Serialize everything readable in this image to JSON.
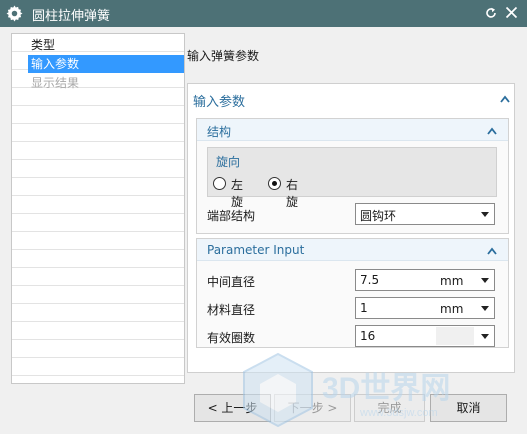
{
  "window": {
    "title": "圆柱拉伸弹簧"
  },
  "nav": {
    "items": [
      {
        "label": "类型",
        "state": "normal"
      },
      {
        "label": "输入参数",
        "state": "selected"
      },
      {
        "label": "显示结果",
        "state": "disabled"
      }
    ]
  },
  "page": {
    "heading": "输入弹簧参数"
  },
  "panel": {
    "title": "输入参数",
    "structure": {
      "title": "结构",
      "direction": {
        "label": "旋向",
        "options": [
          "左旋",
          "右旋"
        ],
        "selected": "右旋"
      },
      "end_structure": {
        "label": "端部结构",
        "value": "圆钩环"
      }
    },
    "parameter_input": {
      "title": "Parameter Input",
      "rows": [
        {
          "label": "中间直径",
          "value": "7.5",
          "unit": "mm"
        },
        {
          "label": "材料直径",
          "value": "1",
          "unit": "mm"
        },
        {
          "label": "有效圈数",
          "value": "16",
          "unit": ""
        }
      ]
    }
  },
  "buttons": {
    "back": "< 上一步",
    "next": "下一步 >",
    "finish": "完成",
    "cancel": "取消"
  },
  "colors": {
    "titlebar": "#4d7176",
    "accent_text": "#2b6e9d",
    "selection": "#3399ff"
  },
  "watermark": {
    "text": "3D世界网",
    "url_text": "www.3dsjw.com"
  }
}
